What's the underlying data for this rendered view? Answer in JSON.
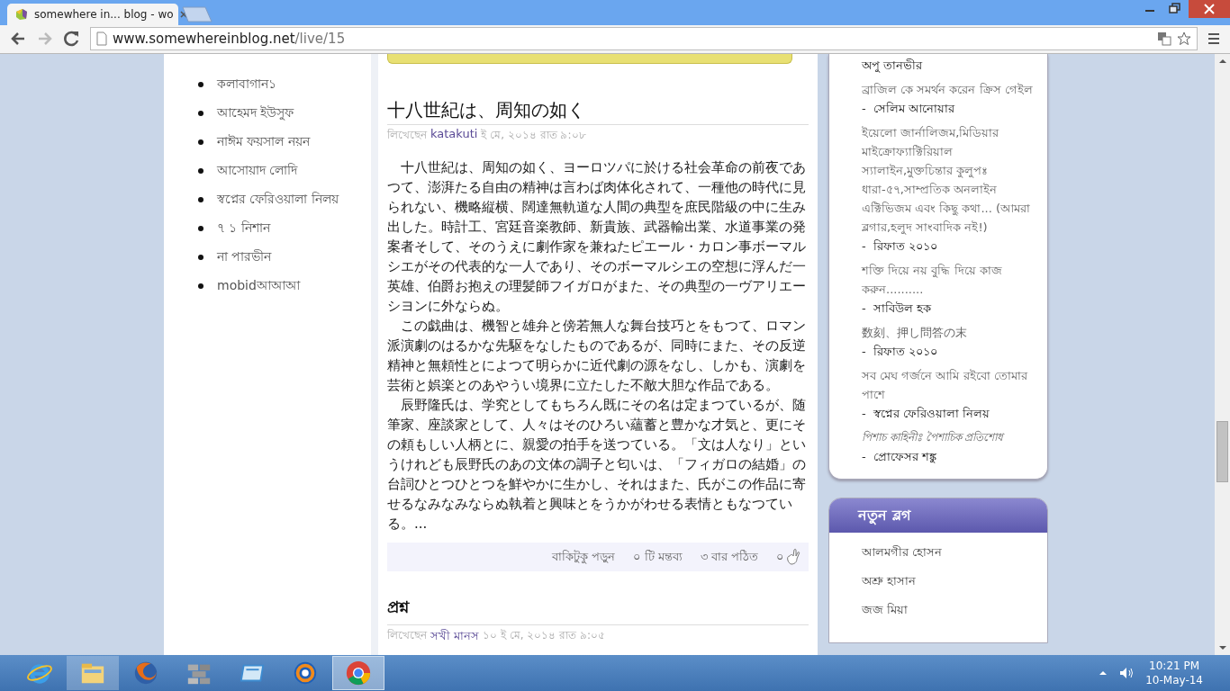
{
  "browser": {
    "tab": {
      "title": "somewhere in... blog - wo",
      "selected": true
    },
    "address": {
      "host": "www.somewhereinblog.net",
      "path": "/live/15"
    }
  },
  "left_list": [
    "কলাবাগান১",
    "আহেমদ ইউসুফ",
    "নাঈম ফয়সাল নয়ন",
    "আসোয়াদ লোদি",
    "স্বপ্নের ফেরিওয়ালা নিলয়",
    "৭ ১ নিশান",
    "না পারভীন",
    "mobidআআআ"
  ],
  "posts": [
    {
      "title": "十八世紀は、周知の如く",
      "byline": "লিখেছেন",
      "author": "katakuti",
      "date": "ই মে, ২০১৪ রাত ৯:০৮",
      "paragraphs": [
        "十八世紀は、周知の如く、ヨーロツパに於ける社会革命の前夜であつて、澎湃たる自由の精神は言わば肉体化されて、一種他の時代に見られない、機略縦横、闊達無軌道な人間の典型を庶民階級の中に生み出した。時計工、宮廷音楽教師、新貴族、武器輸出業、水道事業の発案者そして、そのうえに劇作家を兼ねたピエール・カロン事ボーマルシエがその代表的な一人であり、そのボーマルシエの空想に浮んだ一英雄、伯爵お抱えの理髪師フイガロがまた、その典型の一ヴアリエーシヨンに外ならぬ。",
        "この戯曲は、機智と雄弁と傍若無人な舞台技巧とをもつて、ロマン派演劇のはるかな先駆をなしたものであるが、同時にまた、その反逆精神と無頼性とによつて明らかに近代劇の源をなし、しかも、演劇を芸術と娯楽とのあやうい境界に立たした不敵大胆な作品である。",
        "辰野隆氏は、学究としてもちろん既にその名は定まつているが、随筆家、座談家として、人々はそのひろい蘊蓄と豊かな才気と、更にその頼もしい人柄とに、親愛の拍手を送つている。「文は人なり」というけれども辰野氏のあの文体の調子と匂いは、「フィガロの結婚」の台詞ひとつひとつを鮮やかに生かし、それはまた、氏がこの作品に寄せるなみなみならぬ執着と興味とをうかがわせる表情ともなつている。..."
      ],
      "footer": {
        "read_more": "বাকিটুকু পড়ুন",
        "comments": "০ টি মন্তব্য",
        "views": "৩ বার পঠিত",
        "likes": "০"
      }
    },
    {
      "title": "প্রশ্ন",
      "byline": "লিখেছেন",
      "author": "সখী মানস",
      "date": "১০ ই মে, ২০১৪ রাত ৯:০৫"
    }
  ],
  "recent_posts": [
    {
      "author": "অপু তানভীর"
    },
    {
      "title": "ব্রাজিল কে সমর্থন করেন ক্রিস গেইল",
      "sep": "-",
      "author": "সেলিম আনোয়ার",
      "italic": false
    },
    {
      "title": "ইয়েলো জার্নালিজম,মিডিয়ার মাইক্রোফ্যাক্টিরিয়াল স্যালাইন,মুক্তচিন্তার কুলুপঃ ধারা-৫৭,সাম্প্রতিক অনলাইন এক্টিভিজম এবং কিছু কথা... (আমরা ব্লগার,হলুদ সাংবাদিক নই!)",
      "sep": "-",
      "author": "রিফাত ২০১০",
      "italic": false
    },
    {
      "title": "শক্তি দিয়ে নয় বুদ্ধি দিয়ে কাজ করুন..........",
      "sep": "-",
      "author": "সাবিউল হক",
      "italic": false
    },
    {
      "title": "数刻、押し問答の末",
      "sep": "-",
      "author": "রিফাত ২০১০",
      "italic": false
    },
    {
      "title": "সব মেঘ গর্জনে আমি রইবো তোমার পাশে",
      "sep": "-",
      "author": "স্বপ্নের ফেরিওয়ালা নিলয়",
      "italic": false
    },
    {
      "title": "পিশাচ কাহিনীঃ পৈশাচিক প্রতিশোধ",
      "sep": "-",
      "author": "প্রোফেসর শঙ্কু",
      "italic": true
    }
  ],
  "new_blogs": {
    "title": "নতুন ব্লগ",
    "items": [
      "আলমগীর হোসন",
      "অশ্রু হাসান",
      "জজ মিয়া"
    ]
  },
  "taskbar": {
    "apps": [
      {
        "kind": "ie",
        "running": false,
        "selected": false
      },
      {
        "kind": "explorer",
        "running": true,
        "selected": false
      },
      {
        "kind": "firefox",
        "running": false,
        "selected": false
      },
      {
        "kind": "bricks",
        "running": false,
        "selected": false
      },
      {
        "kind": "window",
        "running": false,
        "selected": false
      },
      {
        "kind": "swirl",
        "running": false,
        "selected": false
      },
      {
        "kind": "chrome",
        "running": true,
        "selected": true
      }
    ],
    "time": "10:21 PM",
    "date": "10-May-14"
  }
}
